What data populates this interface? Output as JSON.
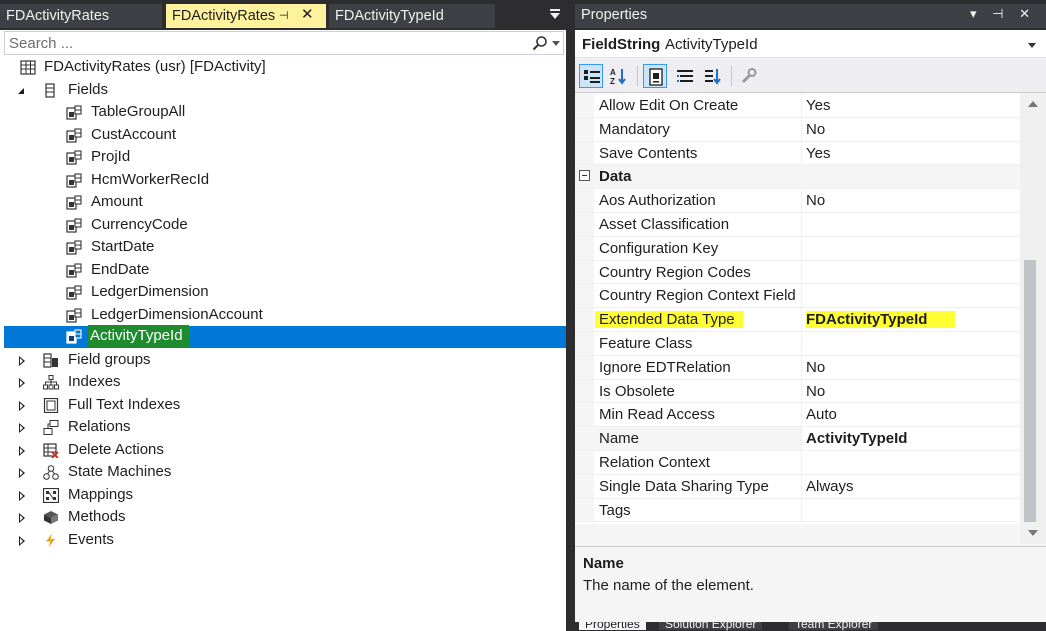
{
  "doc_tabs": [
    {
      "label": "FDActivityRates",
      "active": false
    },
    {
      "label": "FDActivityRates",
      "active": true,
      "pin": "⿻",
      "close": "✕"
    },
    {
      "label": "FDActivityTypeId",
      "active": false
    }
  ],
  "search": {
    "placeholder": "Search ..."
  },
  "tree": {
    "root": "FDActivityRates (usr) [FDActivity]",
    "fields_label": "Fields",
    "fields": [
      "TableGroupAll",
      "CustAccount",
      "ProjId",
      "HcmWorkerRecId",
      "Amount",
      "CurrencyCode",
      "StartDate",
      "EndDate",
      "LedgerDimension",
      "LedgerDimensionAccount",
      "ActivityTypeId"
    ],
    "selected_field": "ActivityTypeId",
    "nodes": [
      {
        "label": "Field groups",
        "icon": "field-groups-icon"
      },
      {
        "label": "Indexes",
        "icon": "indexes-icon"
      },
      {
        "label": "Full Text Indexes",
        "icon": "full-text-indexes-icon"
      },
      {
        "label": "Relations",
        "icon": "relations-icon"
      },
      {
        "label": "Delete Actions",
        "icon": "delete-actions-icon"
      },
      {
        "label": "State Machines",
        "icon": "state-machines-icon"
      },
      {
        "label": "Mappings",
        "icon": "mappings-icon"
      },
      {
        "label": "Methods",
        "icon": "methods-icon"
      },
      {
        "label": "Events",
        "icon": "events-icon"
      }
    ]
  },
  "properties": {
    "title": "Properties",
    "title_buttons": "▾ ⿻ ✕",
    "object_type": "FieldString",
    "object_name": "ActivityTypeId",
    "rows": [
      {
        "name": "Allow Edit On Create",
        "value": "Yes"
      },
      {
        "name": "Mandatory",
        "value": "No"
      },
      {
        "name": "Save Contents",
        "value": "Yes"
      },
      {
        "name": "Data",
        "value": "",
        "category": true
      },
      {
        "name": "Aos Authorization",
        "value": "No"
      },
      {
        "name": "Asset Classification",
        "value": ""
      },
      {
        "name": "Configuration Key",
        "value": ""
      },
      {
        "name": "Country Region Codes",
        "value": ""
      },
      {
        "name": "Country Region Context Field",
        "value": ""
      },
      {
        "name": "Extended Data Type",
        "value": "FDActivityTypeId",
        "highlight": true
      },
      {
        "name": "Feature Class",
        "value": ""
      },
      {
        "name": "Ignore EDTRelation",
        "value": "No"
      },
      {
        "name": "Is Obsolete",
        "value": "No"
      },
      {
        "name": "Min Read Access",
        "value": "Auto"
      },
      {
        "name": "Name",
        "value": "ActivityTypeId",
        "selected": true
      },
      {
        "name": "Relation Context",
        "value": ""
      },
      {
        "name": "Single Data Sharing Type",
        "value": "Always"
      },
      {
        "name": "Tags",
        "value": ""
      }
    ],
    "description_title": "Name",
    "description_text": "The name of the element.",
    "bottom_tabs": [
      "Properties",
      "Solution Explorer",
      "Team Explorer"
    ]
  },
  "colors": {
    "selection": "#0078d7",
    "highlight": "#ffff33",
    "tab_active": "#fff29d"
  }
}
